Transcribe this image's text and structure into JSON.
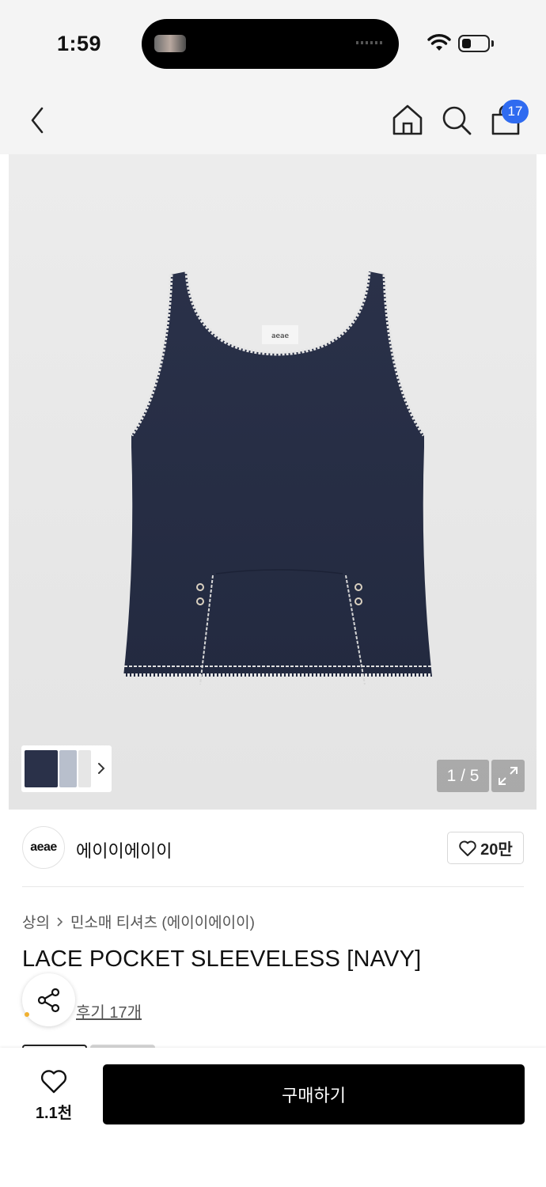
{
  "status_bar": {
    "time": "1:59"
  },
  "nav": {
    "cart_count": "17"
  },
  "gallery": {
    "counter": "1 / 5",
    "garment_color": "#283048",
    "trim_color": "#e8e8e8"
  },
  "brand": {
    "logo_text": "aeae",
    "name": "에이이에이이",
    "likes": "20만"
  },
  "product": {
    "breadcrumb": [
      "상의",
      "민소매 티셔츠 (에이이에이이)"
    ],
    "title": "LACE POCKET SLEEVELESS [NAVY]",
    "review_link": "후기 17개"
  },
  "bottom_bar": {
    "wish_count": "1.1천",
    "buy_label": "구매하기"
  },
  "colors": {
    "badge": "#2f6bf0",
    "buy_button": "#000000"
  }
}
